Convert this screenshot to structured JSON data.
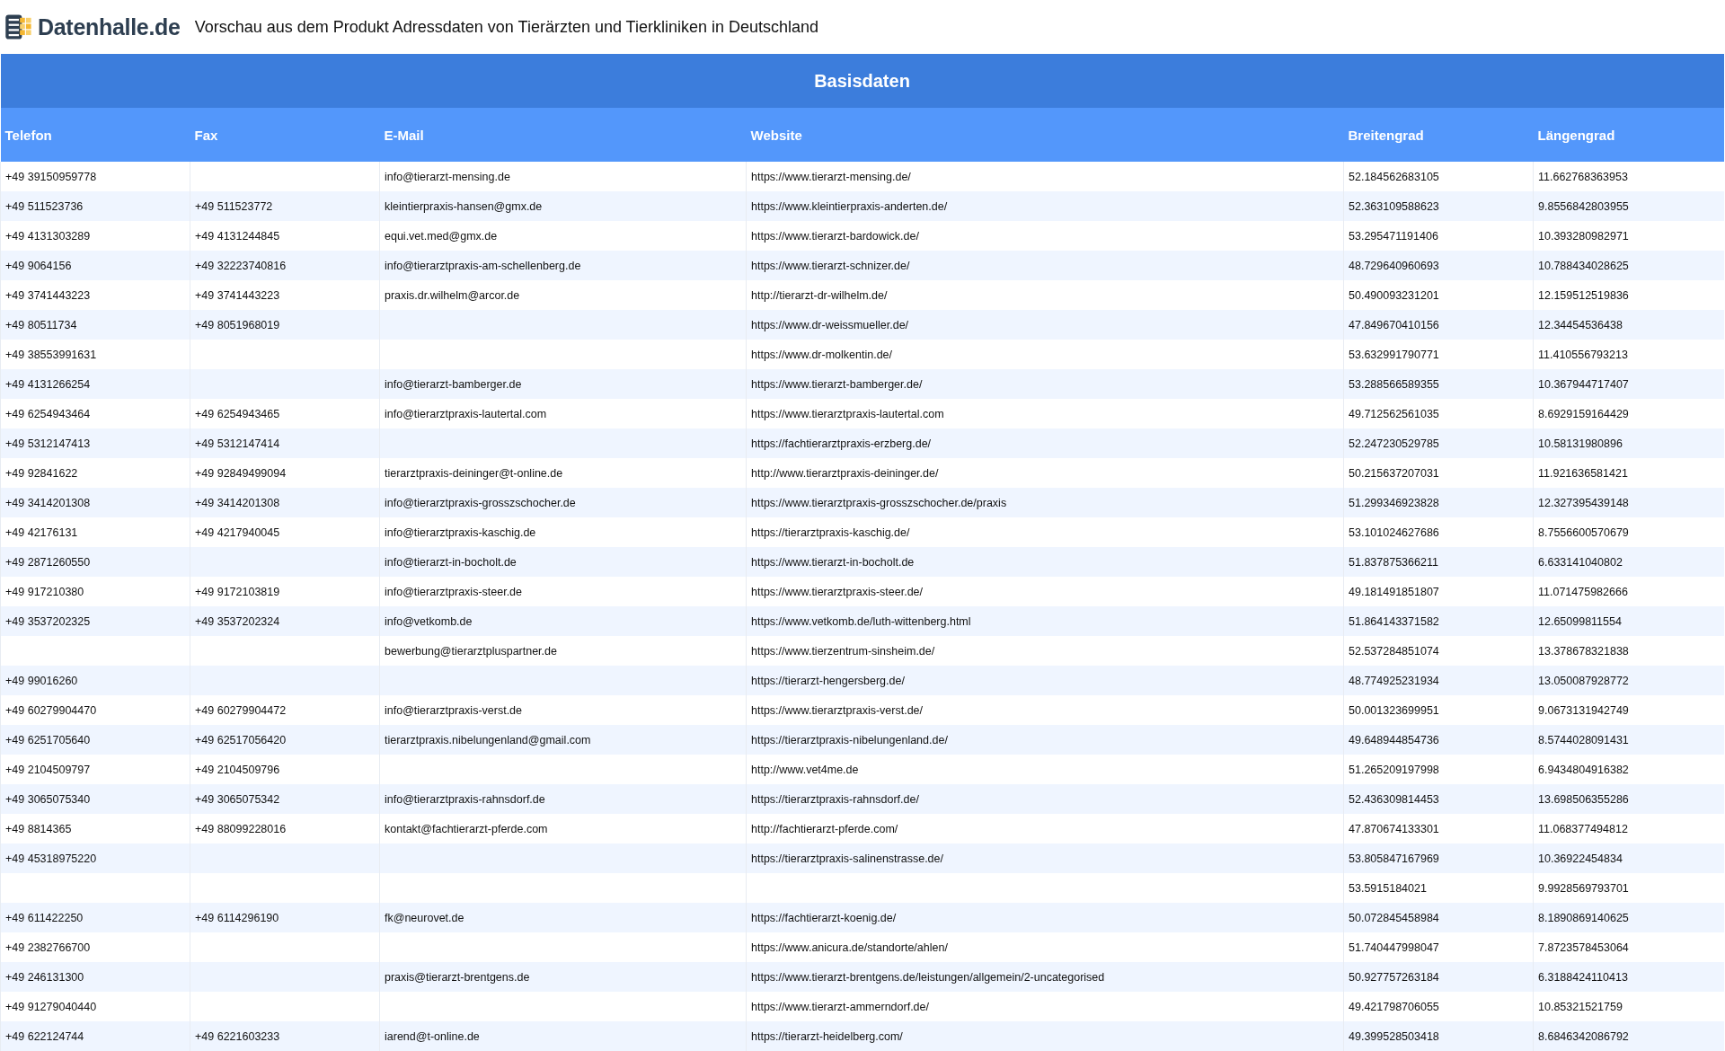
{
  "header": {
    "logo_text": "Datenhalle.de",
    "title": "Vorschau aus dem Produkt Adressdaten von Tierärzten und Tierkliniken in Deutschland"
  },
  "table": {
    "group_heading": "Basisdaten",
    "columns": [
      "Telefon",
      "Fax",
      "E-Mail",
      "Website",
      "Breitengrad",
      "Längengrad"
    ],
    "rows": [
      {
        "phone": "+49 39150959778",
        "email": "info@tierarzt-mensing.de",
        "website": "https://www.tierarzt-mensing.de/",
        "latitude": "52.184562683105",
        "longitude": "11.662768363953"
      },
      {
        "phone": "+49 511523736",
        "fax": "+49 511523772",
        "email": "kleintierpraxis-hansen@gmx.de",
        "website": "https://www.kleintierpraxis-anderten.de/",
        "latitude": "52.363109588623",
        "longitude": "9.8556842803955"
      },
      {
        "phone": "+49 4131303289",
        "fax": "+49 4131244845",
        "email": "equi.vet.med@gmx.de",
        "website": "https://www.tierarzt-bardowick.de/",
        "latitude": "53.295471191406",
        "longitude": "10.393280982971"
      },
      {
        "phone": "+49 9064156",
        "fax": "+49 32223740816",
        "email": "info@tierarztpraxis-am-schellenberg.de",
        "website": "https://www.tierarzt-schnizer.de/",
        "latitude": "48.729640960693",
        "longitude": "10.788434028625"
      },
      {
        "phone": "+49 3741443223",
        "fax": "+49 3741443223",
        "email": "praxis.dr.wilhelm@arcor.de",
        "website": "http://tierarzt-dr-wilhelm.de/",
        "latitude": "50.490093231201",
        "longitude": "12.159512519836"
      },
      {
        "phone": "+49 80511734",
        "fax": "+49 8051968019",
        "website": "https://www.dr-weissmueller.de/",
        "latitude": "47.849670410156",
        "longitude": "12.34454536438"
      },
      {
        "phone": "+49 38553991631",
        "website": "https://www.dr-molkentin.de/",
        "latitude": "53.632991790771",
        "longitude": "11.410556793213"
      },
      {
        "phone": "+49 4131266254",
        "email": "info@tierarzt-bamberger.de",
        "website": "https://www.tierarzt-bamberger.de/",
        "latitude": "53.288566589355",
        "longitude": "10.367944717407"
      },
      {
        "phone": "+49 6254943464",
        "fax": "+49 6254943465",
        "email": "info@tierarztpraxis-lautertal.com",
        "website": "https://www.tierarztpraxis-lautertal.com",
        "latitude": "49.712562561035",
        "longitude": "8.6929159164429"
      },
      {
        "phone": "+49 5312147413",
        "fax": "+49 5312147414",
        "website": "https://fachtierarztpraxis-erzberg.de/",
        "latitude": "52.247230529785",
        "longitude": "10.58131980896"
      },
      {
        "phone": "+49 92841622",
        "fax": "+49 92849499094",
        "email": "tierarztpraxis-deininger@t-online.de",
        "website": "http://www.tierarztpraxis-deininger.de/",
        "latitude": "50.215637207031",
        "longitude": "11.921636581421"
      },
      {
        "phone": "+49 3414201308",
        "fax": "+49 3414201308",
        "email": "info@tierarztpraxis-grosszschocher.de",
        "website": "https://www.tierarztpraxis-grosszschocher.de/praxis",
        "latitude": "51.299346923828",
        "longitude": "12.327395439148"
      },
      {
        "phone": "+49 42176131",
        "fax": "+49 4217940045",
        "email": "info@tierarztpraxis-kaschig.de",
        "website": "https://tierarztpraxis-kaschig.de/",
        "latitude": "53.101024627686",
        "longitude": "8.7556600570679"
      },
      {
        "phone": "+49 2871260550",
        "email": "info@tierarzt-in-bocholt.de",
        "website": "https://www.tierarzt-in-bocholt.de",
        "latitude": "51.837875366211",
        "longitude": "6.633141040802"
      },
      {
        "phone": "+49 917210380",
        "fax": "+49 9172103819",
        "email": "info@tierarztpraxis-steer.de",
        "website": "https://www.tierarztpraxis-steer.de/",
        "latitude": "49.181491851807",
        "longitude": "11.071475982666"
      },
      {
        "phone": "+49 3537202325",
        "fax": "+49 3537202324",
        "email": "info@vetkomb.de",
        "website": "https://www.vetkomb.de/luth-wittenberg.html",
        "latitude": "51.864143371582",
        "longitude": "12.65099811554"
      },
      {
        "email": "bewerbung@tierarztpluspartner.de",
        "website": "https://www.tierzentrum-sinsheim.de/",
        "latitude": "52.537284851074",
        "longitude": "13.378678321838"
      },
      {
        "phone": "+49 99016260",
        "website": "https://tierarzt-hengersberg.de/",
        "latitude": "48.774925231934",
        "longitude": "13.050087928772"
      },
      {
        "phone": "+49 60279904470",
        "fax": "+49 60279904472",
        "email": "info@tierarztpraxis-verst.de",
        "website": "https://www.tierarztpraxis-verst.de/",
        "latitude": "50.001323699951",
        "longitude": "9.0673131942749"
      },
      {
        "phone": "+49 6251705640",
        "fax": "+49 62517056420",
        "email": "tierarztpraxis.nibelungenland@gmail.com",
        "website": "https://tierarztpraxis-nibelungenland.de/",
        "latitude": "49.648944854736",
        "longitude": "8.5744028091431"
      },
      {
        "phone": "+49 2104509797",
        "fax": "+49 2104509796",
        "website": "http://www.vet4me.de",
        "latitude": "51.265209197998",
        "longitude": "6.9434804916382"
      },
      {
        "phone": "+49 3065075340",
        "fax": "+49 3065075342",
        "email": "info@tierarztpraxis-rahnsdorf.de",
        "website": "https://tierarztpraxis-rahnsdorf.de/",
        "latitude": "52.436309814453",
        "longitude": "13.698506355286"
      },
      {
        "phone": "+49 8814365",
        "fax": "+49 88099228016",
        "email": "kontakt@fachtierarzt-pferde.com",
        "website": "http://fachtierarzt-pferde.com/",
        "latitude": "47.870674133301",
        "longitude": "11.068377494812"
      },
      {
        "phone": "+49 45318975220",
        "website": "https://tierarztpraxis-salinenstrasse.de/",
        "latitude": "53.805847167969",
        "longitude": "10.36922454834"
      },
      {
        "latitude": "53.5915184021",
        "longitude": "9.9928569793701"
      },
      {
        "phone": "+49 611422250",
        "fax": "+49 6114296190",
        "email": "fk@neurovet.de",
        "website": "https://fachtierarzt-koenig.de/",
        "latitude": "50.072845458984",
        "longitude": "8.1890869140625"
      },
      {
        "phone": "+49 2382766700",
        "website": "https://www.anicura.de/standorte/ahlen/",
        "latitude": "51.740447998047",
        "longitude": "7.8723578453064"
      },
      {
        "phone": "+49 246131300",
        "email": "praxis@tierarzt-brentgens.de",
        "website": "https://www.tierarzt-brentgens.de/leistungen/allgemein/2-uncategorised",
        "latitude": "50.927757263184",
        "longitude": "6.3188424110413"
      },
      {
        "phone": "+49 91279040440",
        "website": "https://www.tierarzt-ammerndorf.de/",
        "latitude": "49.421798706055",
        "longitude": "10.85321521759"
      },
      {
        "phone": "+49 622124744",
        "fax": "+49 6221603233",
        "email": "iarend@t-online.de",
        "website": "https://tierarzt-heidelberg.com/",
        "latitude": "49.399528503418",
        "longitude": "8.6846342086792"
      }
    ]
  }
}
